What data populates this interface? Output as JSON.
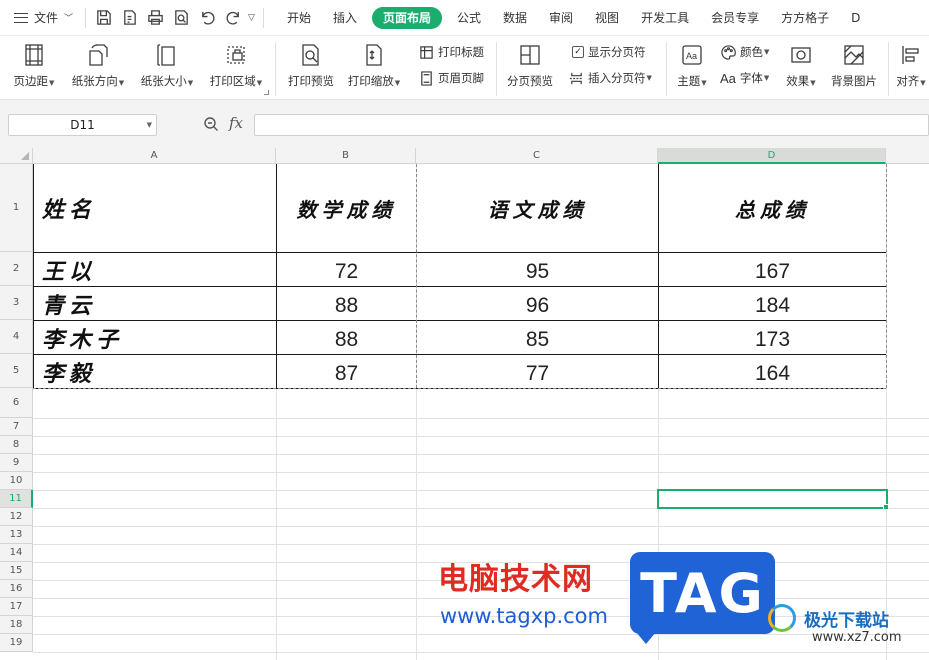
{
  "menubar": {
    "file_label": "文件",
    "tabs": [
      "开始",
      "插入",
      "页面布局",
      "公式",
      "数据",
      "审阅",
      "视图",
      "开发工具",
      "会员专享",
      "方方格子",
      "D"
    ],
    "active_tab": "页面布局"
  },
  "ribbon": {
    "margins": "页边距",
    "orientation": "纸张方向",
    "size": "纸张大小",
    "print_area": "打印区域",
    "print_preview": "打印预览",
    "print_scale": "打印缩放",
    "print_titles": "打印标题",
    "header_footer": "页眉页脚",
    "page_break_preview": "分页预览",
    "show_page_breaks": "显示分页符",
    "insert_page_break": "插入分页符",
    "theme": "主题",
    "colors": "颜色",
    "fonts": "字体",
    "effects": "效果",
    "background": "背景图片",
    "align": "对齐"
  },
  "formula_bar": {
    "name_box": "D11",
    "fx": "fx",
    "formula": ""
  },
  "sheet": {
    "columns": [
      "A",
      "B",
      "C",
      "D"
    ],
    "selected_column": "D",
    "rows": [
      "1",
      "2",
      "3",
      "4",
      "5",
      "6",
      "7",
      "8",
      "9",
      "10",
      "11",
      "12",
      "13",
      "14",
      "15",
      "16",
      "17",
      "18",
      "19"
    ],
    "selected_row": "11",
    "header": [
      "姓名",
      "数学成绩",
      "语文成绩",
      "总成绩"
    ],
    "data": [
      [
        "王以",
        "72",
        "95",
        "167"
      ],
      [
        "青云",
        "88",
        "96",
        "184"
      ],
      [
        "李木子",
        "88",
        "85",
        "173"
      ],
      [
        "李毅",
        "87",
        "77",
        "164"
      ]
    ]
  },
  "watermark": {
    "cn": "电脑技术网",
    "url": "www.tagxp.com",
    "tag": "TAG",
    "site": "极光下载站",
    "site_url": "www.xz7.com"
  }
}
